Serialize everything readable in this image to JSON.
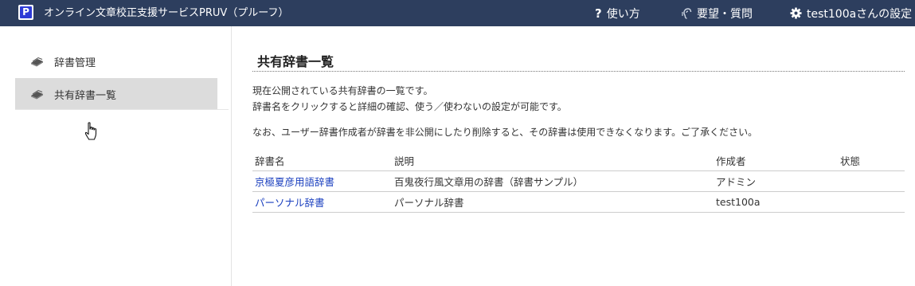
{
  "header": {
    "logo_letter": "P",
    "app_title": "オンライン文章校正支援サービスPRUV（プルーフ）",
    "nav": {
      "help": "使い方",
      "request": "要望・質問",
      "settings": "test100aさんの設定"
    },
    "icons": {
      "help": "question-icon",
      "request": "hand-ear-icon",
      "settings": "gear-icon"
    }
  },
  "sidebar": {
    "items": [
      {
        "label": "辞書管理",
        "icon": "book-icon",
        "active": false
      },
      {
        "label": "共有辞書一覧",
        "icon": "book-icon",
        "active": true
      }
    ]
  },
  "main": {
    "title": "共有辞書一覧",
    "desc_line1": "現在公開されている共有辞書の一覧です。",
    "desc_line2": "辞書名をクリックすると詳細の確認、使う／使わないの設定が可能です。",
    "desc_line3": "なお、ユーザー辞書作成者が辞書を非公開にしたり削除すると、その辞書は使用できなくなります。ご了承ください。",
    "table": {
      "headers": {
        "name": "辞書名",
        "description": "説明",
        "author": "作成者",
        "status": "状態"
      },
      "rows": [
        {
          "name": "京極夏彦用語辞書",
          "description": "百鬼夜行風文章用の辞書（辞書サンプル）",
          "author": "アドミン",
          "status": ""
        },
        {
          "name": "パーソナル辞書",
          "description": "パーソナル辞書",
          "author": "test100a",
          "status": ""
        }
      ]
    }
  },
  "colors": {
    "topbar": "#2d3e5e",
    "logo": "#2e3bd6",
    "link": "#1a3fbf",
    "sidebar_active": "#dcdcdc"
  }
}
